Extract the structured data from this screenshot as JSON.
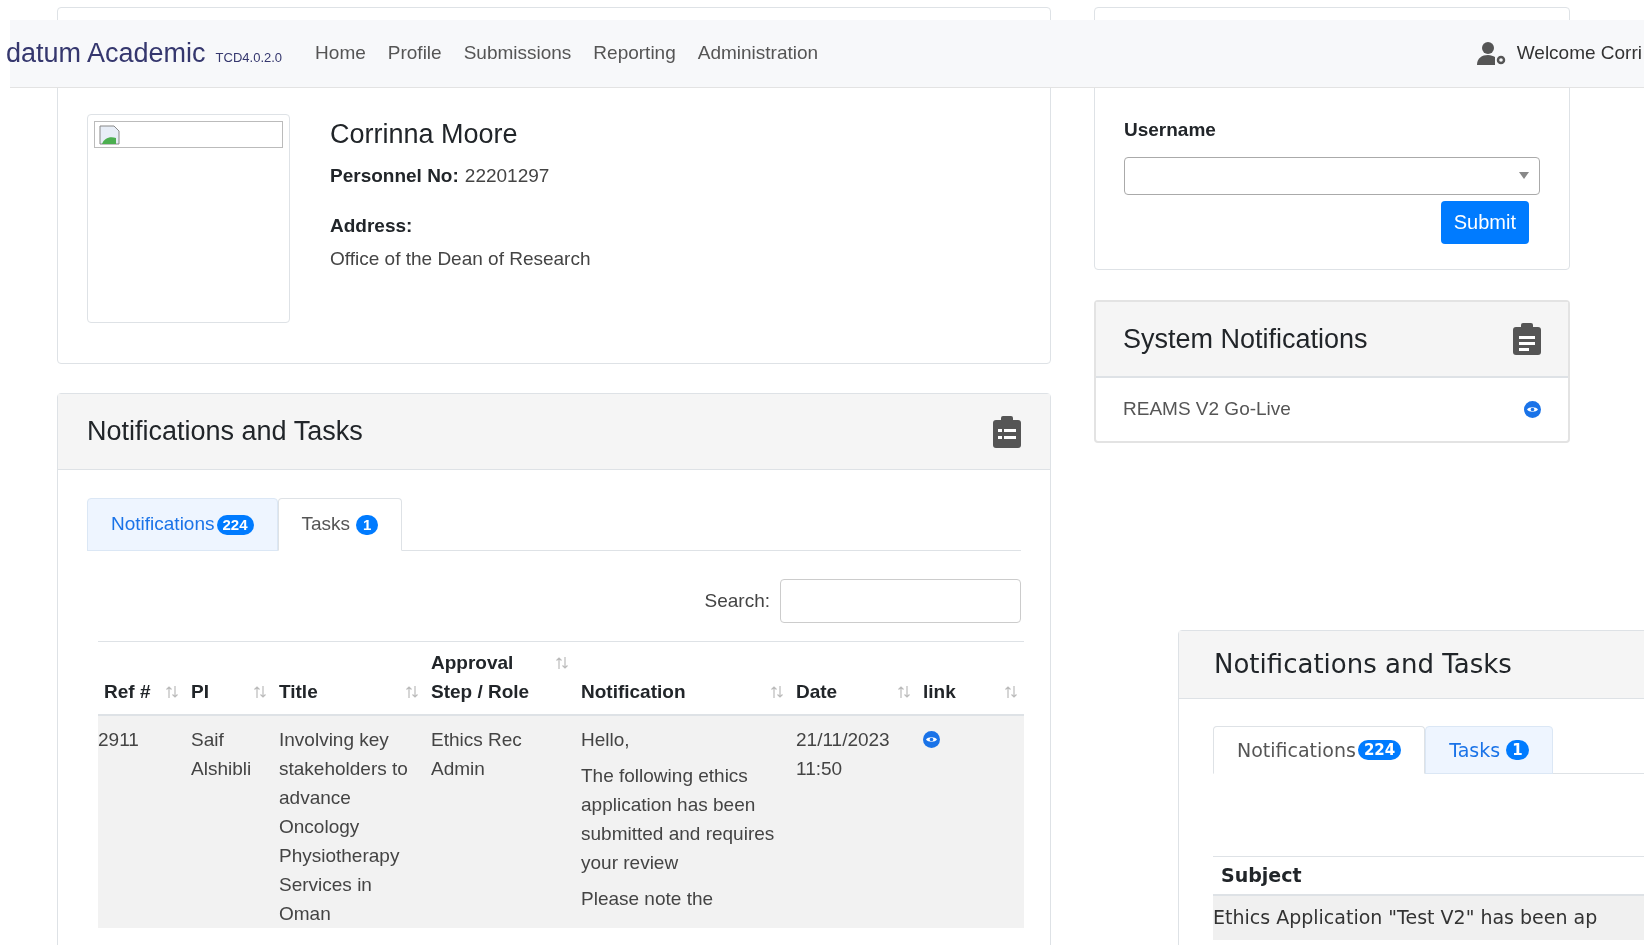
{
  "navbar": {
    "brand": "datum Academic",
    "version": "TCD4.0.2.0",
    "links": [
      "Home",
      "Profile",
      "Submissions",
      "Reporting",
      "Administration"
    ],
    "welcome": "Welcome Corri"
  },
  "profile": {
    "name": "Corrinna Moore",
    "personnel_label": "Personnel No:",
    "personnel_no": "22201297",
    "address_label": "Address:",
    "address": "Office of the Dean of Research"
  },
  "user_select": {
    "label": "Username",
    "button": "Submit"
  },
  "system_notifications": {
    "title": "System Notifications",
    "items": [
      {
        "text": "REAMS V2 Go-Live"
      }
    ]
  },
  "notifications_tasks": {
    "title": "Notifications and Tasks",
    "tabs": [
      {
        "label": "Notifications",
        "count": "224",
        "selected": true
      },
      {
        "label": "Tasks",
        "count": "1",
        "selected": false
      }
    ],
    "search_label": "Search:",
    "table": {
      "columns": [
        "Ref #",
        "PI",
        "Title",
        "Approval Step / Role",
        "Notification",
        "Date",
        "link"
      ],
      "rows": [
        {
          "ref": "2911",
          "pi": "Saif Alshibli",
          "title": "Involving key stakeholders to advance Oncology Physiotherapy Services in Oman",
          "role": "Ethics Rec Admin",
          "notification": [
            "Hello,",
            "The following ethics application has been submitted and requires your review",
            "Please note the"
          ],
          "date": "21/11/2023 11:50"
        }
      ]
    }
  },
  "notifications_tasks_popup": {
    "title": "Notifications and Tasks",
    "tabs": [
      {
        "label": "Notifications",
        "count": "224",
        "selected": false
      },
      {
        "label": "Tasks",
        "count": "1",
        "selected": true
      }
    ],
    "table": {
      "columns": [
        "Subject"
      ],
      "rows": [
        [
          "Ethics Application \"Test V2\" has been ap"
        ]
      ]
    }
  }
}
